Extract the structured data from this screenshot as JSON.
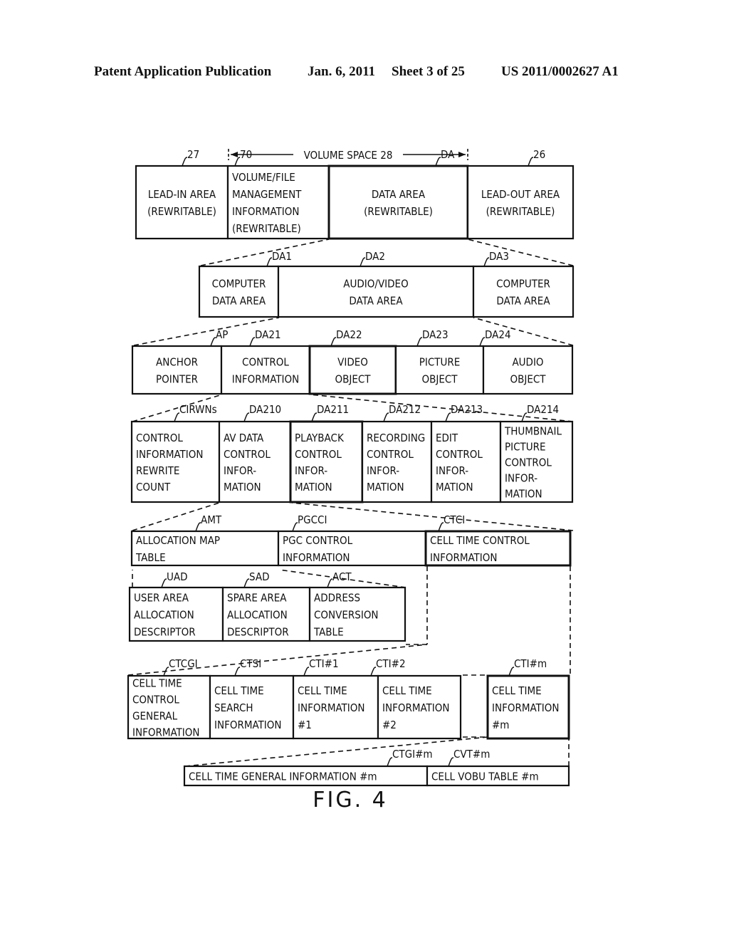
{
  "header": {
    "publication": "Patent Application Publication",
    "date": "Jan. 6, 2011",
    "sheet": "Sheet 3 of 25",
    "number": "US 2011/0002627 A1"
  },
  "volume_space_label": "VOLUME SPACE 28",
  "rows": [
    {
      "name": "disc-layout",
      "cells": [
        {
          "ref": "27",
          "lines": [
            "LEAD-IN AREA",
            "(REWRITABLE)"
          ]
        },
        {
          "ref": "70",
          "lines": [
            "VOLUME/FILE",
            "MANAGEMENT",
            "INFORMATION",
            "(REWRITABLE)"
          ]
        },
        {
          "ref": "DA",
          "lines": [
            "DATA AREA",
            "(REWRITABLE)"
          ]
        },
        {
          "ref": "26",
          "lines": [
            "LEAD-OUT AREA",
            "(REWRITABLE)"
          ]
        }
      ]
    },
    {
      "name": "data-area",
      "cells": [
        {
          "ref": "DA1",
          "lines": [
            "COMPUTER",
            "DATA AREA"
          ]
        },
        {
          "ref": "DA2",
          "lines": [
            "AUDIO/VIDEO",
            "DATA AREA"
          ]
        },
        {
          "ref": "DA3",
          "lines": [
            "COMPUTER",
            "DATA AREA"
          ]
        }
      ]
    },
    {
      "name": "av-data-area",
      "cells": [
        {
          "ref": "AP",
          "lines": [
            "ANCHOR",
            "POINTER"
          ]
        },
        {
          "ref": "DA21",
          "lines": [
            "CONTROL",
            "INFORMATION"
          ]
        },
        {
          "ref": "DA22",
          "lines": [
            "VIDEO",
            "OBJECT"
          ]
        },
        {
          "ref": "DA23",
          "lines": [
            "PICTURE",
            "OBJECT"
          ]
        },
        {
          "ref": "DA24",
          "lines": [
            "AUDIO",
            "OBJECT"
          ]
        }
      ]
    },
    {
      "name": "control-information",
      "cells": [
        {
          "ref": "CIRWNs",
          "lines": [
            "CONTROL",
            "INFORMATION",
            "REWRITE",
            "COUNT"
          ]
        },
        {
          "ref": "DA210",
          "lines": [
            "AV DATA",
            "CONTROL",
            "INFOR-",
            "MATION"
          ]
        },
        {
          "ref": "DA211",
          "lines": [
            "PLAYBACK",
            "CONTROL",
            "INFOR-",
            "MATION"
          ]
        },
        {
          "ref": "DA212",
          "lines": [
            "RECORDING",
            "CONTROL",
            "INFOR-",
            "MATION"
          ]
        },
        {
          "ref": "DA213",
          "lines": [
            "EDIT",
            "CONTROL",
            "INFOR-",
            "MATION"
          ]
        },
        {
          "ref": "DA214",
          "lines": [
            "THUMBNAIL",
            "PICTURE",
            "CONTROL",
            "INFOR-",
            "MATION"
          ]
        }
      ]
    },
    {
      "name": "av-data-control",
      "cells": [
        {
          "ref": "AMT",
          "lines": [
            "ALLOCATION MAP",
            "TABLE"
          ]
        },
        {
          "ref": "PGCCI",
          "lines": [
            "PGC CONTROL",
            "INFORMATION"
          ]
        },
        {
          "ref": "CTCI",
          "lines": [
            "CELL TIME CONTROL",
            "INFORMATION"
          ]
        }
      ]
    },
    {
      "name": "allocation-map",
      "cells": [
        {
          "ref": "UAD",
          "lines": [
            "USER AREA",
            "ALLOCATION",
            "DESCRIPTOR"
          ]
        },
        {
          "ref": "SAD",
          "lines": [
            "SPARE AREA",
            "ALLOCATION",
            "DESCRIPTOR"
          ]
        },
        {
          "ref": "ACT",
          "lines": [
            "ADDRESS",
            "CONVERSION",
            "TABLE"
          ]
        }
      ]
    },
    {
      "name": "cell-time-control",
      "cells": [
        {
          "ref": "CTCGI",
          "lines": [
            "CELL TIME",
            "CONTROL",
            "GENERAL",
            "INFORMATION"
          ]
        },
        {
          "ref": "CTSI",
          "lines": [
            "CELL TIME",
            "SEARCH",
            "INFORMATION"
          ]
        },
        {
          "ref": "CTI#1",
          "lines": [
            "CELL TIME",
            "INFORMATION",
            "#1"
          ]
        },
        {
          "ref": "CTI#2",
          "lines": [
            "CELL TIME",
            "INFORMATION",
            "#2"
          ]
        },
        {
          "ref": "CTI#m",
          "lines": [
            "CELL TIME",
            "INFORMATION",
            "#m"
          ]
        }
      ]
    },
    {
      "name": "cell-time-information",
      "cells": [
        {
          "ref": "CTGI#m",
          "lines": [
            "CELL TIME GENERAL INFORMATION #m"
          ]
        },
        {
          "ref": "CVT#m",
          "lines": [
            "CELL VOBU TABLE #m"
          ]
        }
      ]
    }
  ],
  "figure_label": "FIG. 4"
}
